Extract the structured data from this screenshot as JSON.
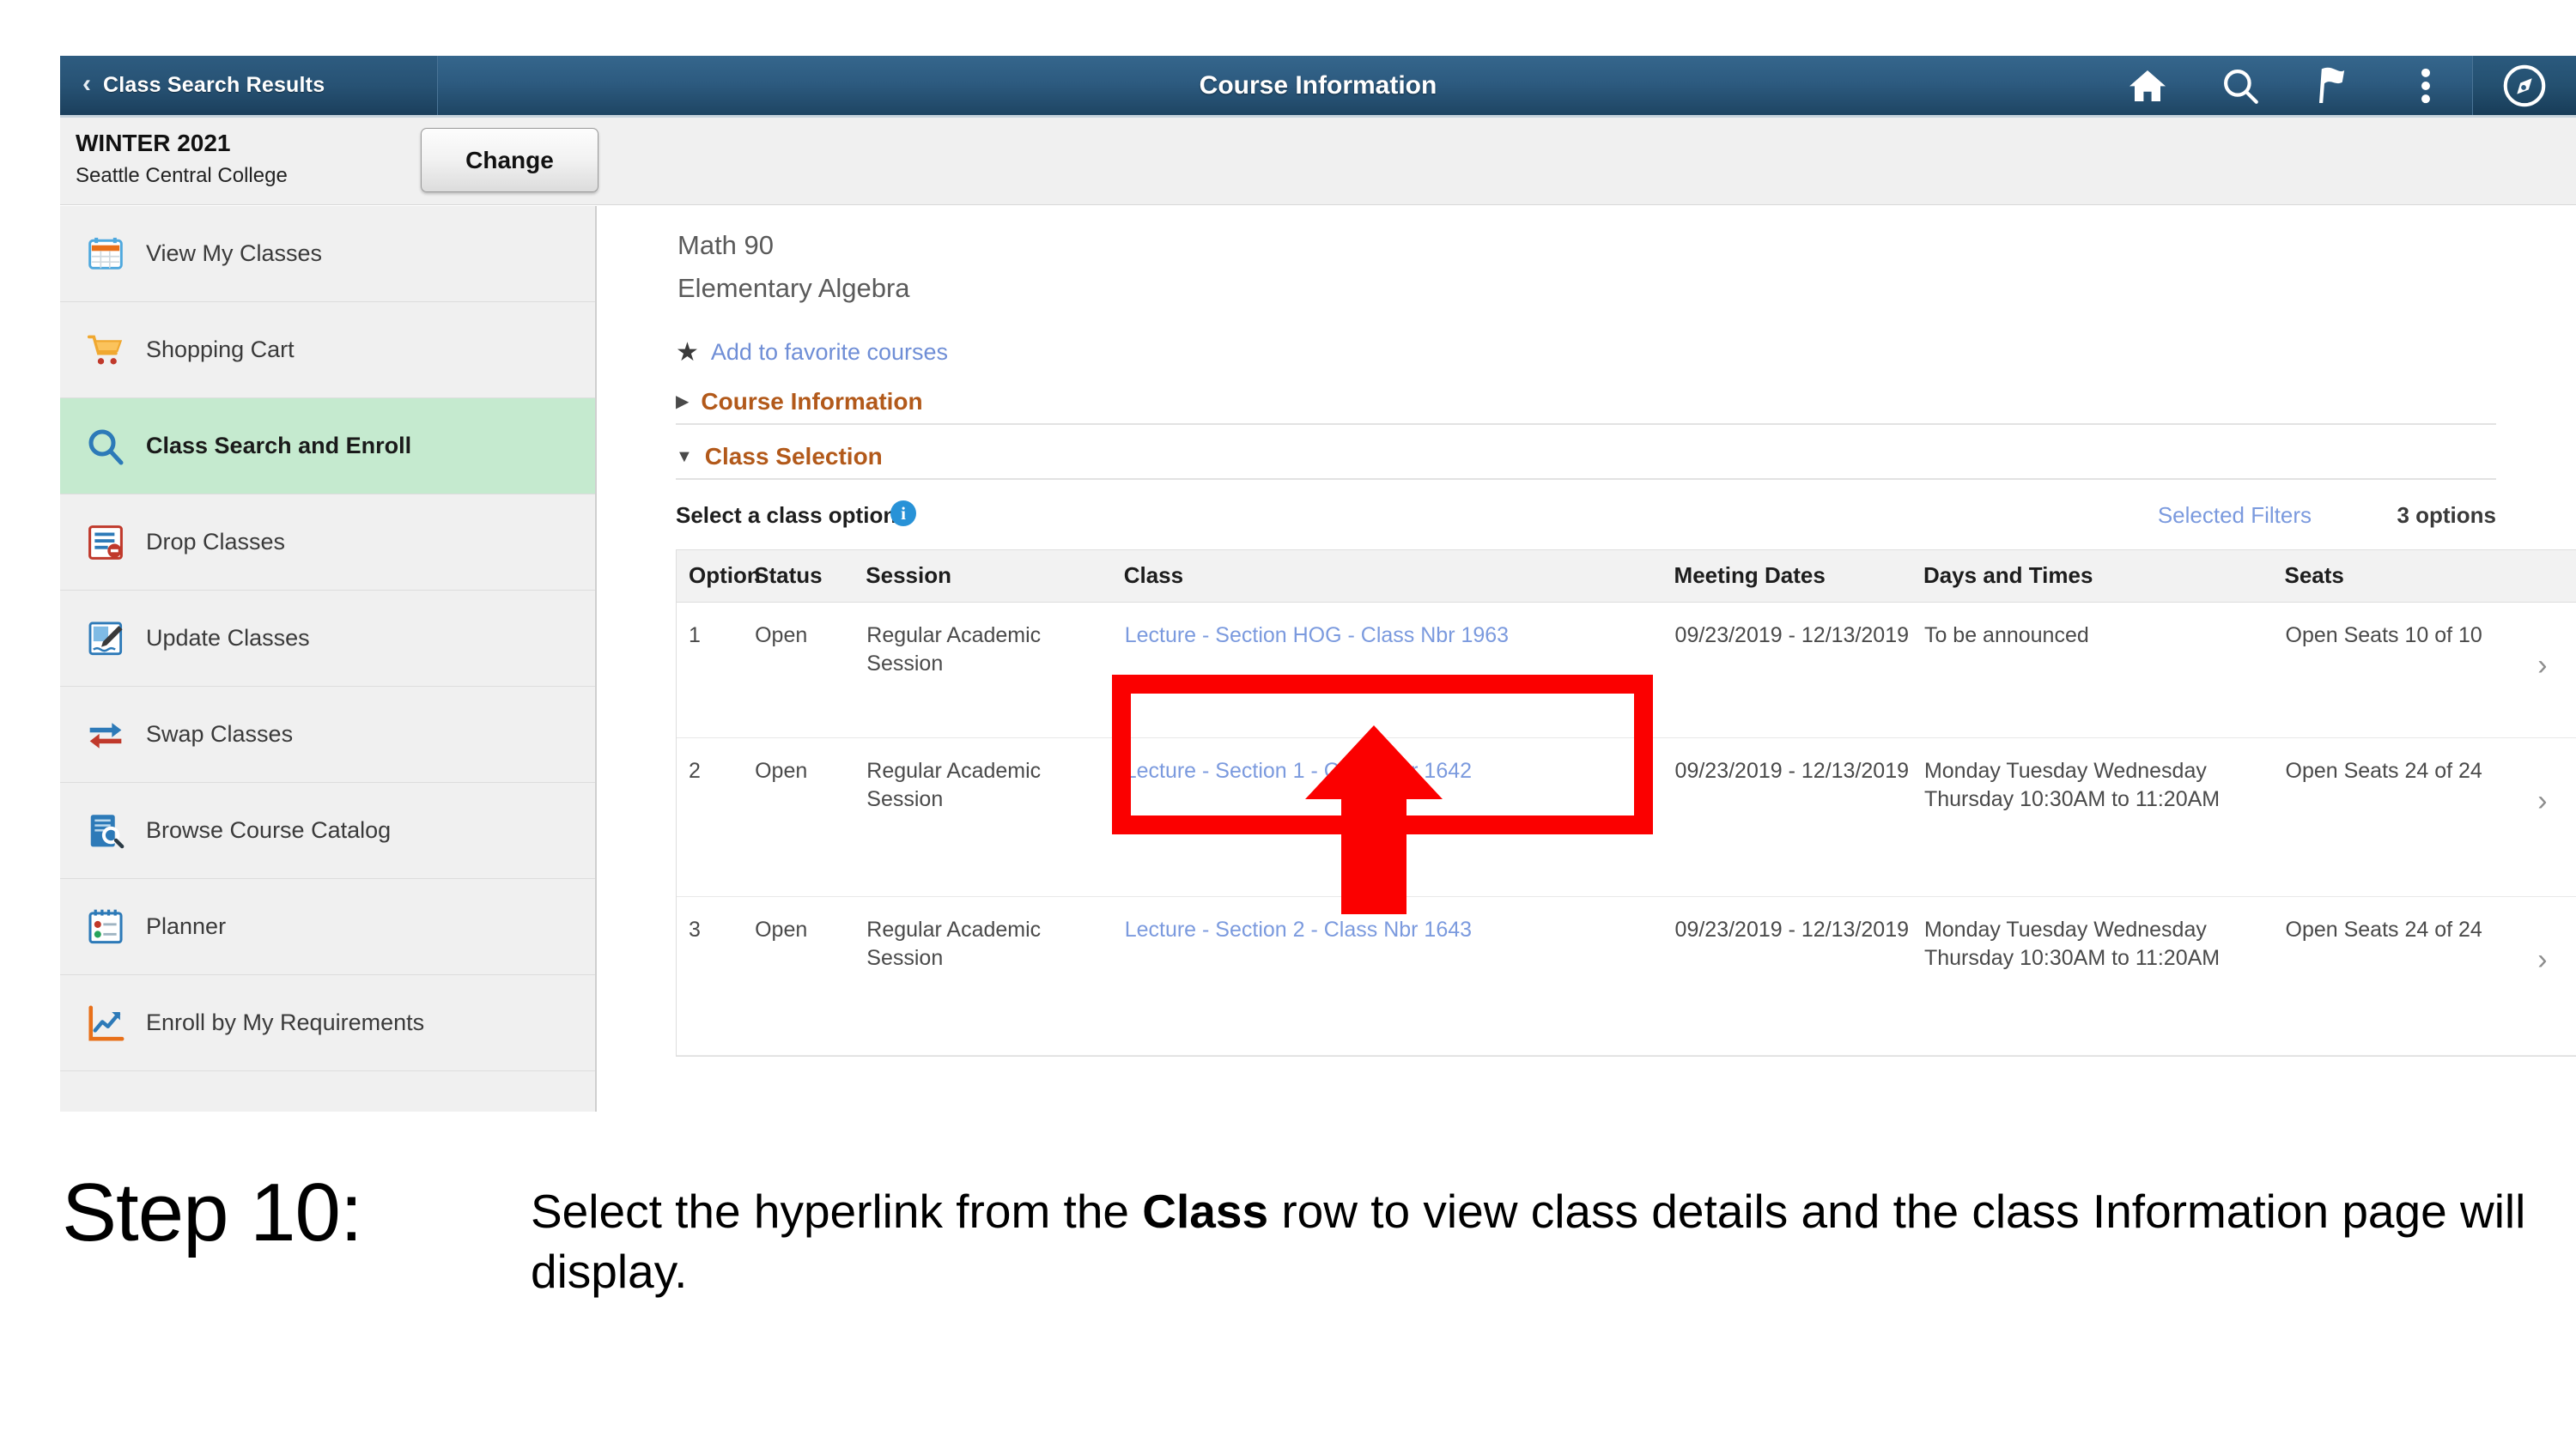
{
  "header": {
    "back_label": "Class Search Results",
    "back_icon": "chevron-left-icon",
    "title": "Course Information",
    "icons": [
      {
        "name": "home-icon",
        "label": "Home"
      },
      {
        "name": "search-icon",
        "label": "Search"
      },
      {
        "name": "flag-icon",
        "label": "Notifications"
      },
      {
        "name": "kebab-menu-icon",
        "label": "Actions"
      },
      {
        "name": "compass-icon",
        "label": "NavBar"
      }
    ],
    "bar_color": "#2d5b80"
  },
  "term": {
    "name": "WINTER 2021",
    "school": "Seattle Central College",
    "change_label": "Change"
  },
  "sidebar": {
    "items": [
      {
        "label": "View My Classes",
        "icon": "calendar-icon",
        "active": false
      },
      {
        "label": "Shopping Cart",
        "icon": "shopping-cart-icon",
        "active": false
      },
      {
        "label": "Class Search and Enroll",
        "icon": "magnifier-icon",
        "active": true
      },
      {
        "label": "Drop Classes",
        "icon": "drop-classes-icon",
        "active": false
      },
      {
        "label": "Update Classes",
        "icon": "edit-document-icon",
        "active": false
      },
      {
        "label": "Swap Classes",
        "icon": "swap-arrows-icon",
        "active": false
      },
      {
        "label": "Browse Course Catalog",
        "icon": "catalog-search-icon",
        "active": false
      },
      {
        "label": "Planner",
        "icon": "planner-calendar-icon",
        "active": false
      },
      {
        "label": "Enroll by My Requirements",
        "icon": "chart-line-icon",
        "active": false
      }
    ],
    "active_color": "#c5eacf"
  },
  "main": {
    "course_number": "Math 90",
    "course_title": "Elementary Algebra",
    "favorite_link": "Add to favorite courses",
    "favorite_icon": "star-icon",
    "sections": [
      {
        "label": "Course Information",
        "expanded": false,
        "caret": "caret-right-icon"
      },
      {
        "label": "Class Selection",
        "expanded": true,
        "caret": "caret-down-icon"
      }
    ],
    "section_color": "#b2591a",
    "select_prompt": "Select a class option",
    "info_icon": "info-icon",
    "filters_link": "Selected Filters",
    "options_count": "3 options",
    "link_color": "#7b9ade"
  },
  "table": {
    "columns": [
      "Option",
      "Status",
      "Session",
      "Class",
      "Meeting Dates",
      "Days and Times",
      "Seats"
    ],
    "rows": [
      {
        "option": "1",
        "status": "Open",
        "session": "Regular Academic Session",
        "class": "Lecture - Section HOG - Class Nbr 1963",
        "meeting_dates": "09/23/2019 - 12/13/2019",
        "days_and_times": "To be announced",
        "seats": "Open Seats 10 of 10",
        "chevron": "chevron-right-icon"
      },
      {
        "option": "2",
        "status": "Open",
        "session": "Regular Academic Session",
        "class": "Lecture - Section 1 - Class Nbr 1642",
        "meeting_dates": "09/23/2019 - 12/13/2019",
        "days_and_times": "Monday Tuesday Wednesday Thursday 10:30AM to 11:20AM",
        "seats": "Open Seats 24 of 24",
        "chevron": "chevron-right-icon"
      },
      {
        "option": "3",
        "status": "Open",
        "session": "Regular Academic Session",
        "class": "Lecture - Section 2 - Class Nbr 1643",
        "meeting_dates": "09/23/2019 - 12/13/2019",
        "days_and_times": "Monday Tuesday Wednesday Thursday 10:30AM to 11:20AM",
        "seats": "Open Seats 24 of 24",
        "chevron": "chevron-right-icon"
      }
    ]
  },
  "annotation": {
    "color": "#fb0000",
    "shapes": [
      "highlight-rectangle",
      "up-arrow"
    ],
    "targets_row": "1",
    "targets_column": "Class"
  },
  "caption": {
    "step_label": "Step 10:",
    "text_part_1": "Select the hyperlink from the ",
    "text_bold": "Class",
    "text_part_2": " row to view class details and the class Information page will display."
  }
}
